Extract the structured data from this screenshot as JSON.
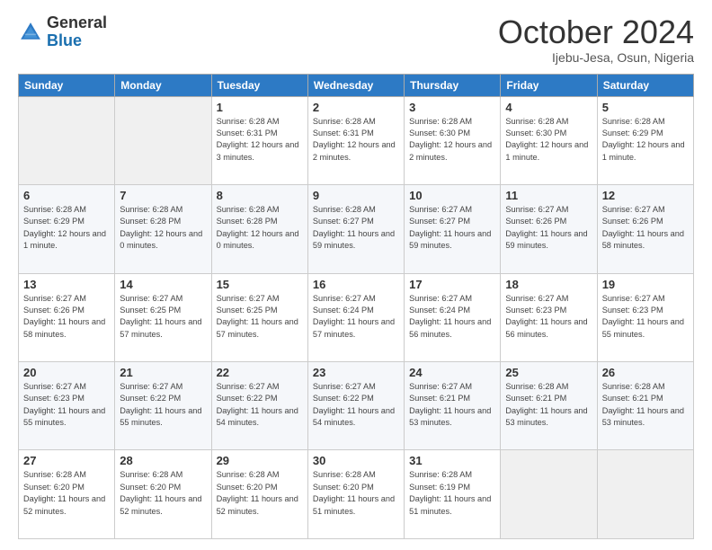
{
  "logo": {
    "general": "General",
    "blue": "Blue"
  },
  "title": "October 2024",
  "location": "Ijebu-Jesa, Osun, Nigeria",
  "headers": [
    "Sunday",
    "Monday",
    "Tuesday",
    "Wednesday",
    "Thursday",
    "Friday",
    "Saturday"
  ],
  "weeks": [
    [
      {
        "day": "",
        "info": ""
      },
      {
        "day": "",
        "info": ""
      },
      {
        "day": "1",
        "info": "Sunrise: 6:28 AM\nSunset: 6:31 PM\nDaylight: 12 hours and 3 minutes."
      },
      {
        "day": "2",
        "info": "Sunrise: 6:28 AM\nSunset: 6:31 PM\nDaylight: 12 hours and 2 minutes."
      },
      {
        "day": "3",
        "info": "Sunrise: 6:28 AM\nSunset: 6:30 PM\nDaylight: 12 hours and 2 minutes."
      },
      {
        "day": "4",
        "info": "Sunrise: 6:28 AM\nSunset: 6:30 PM\nDaylight: 12 hours and 1 minute."
      },
      {
        "day": "5",
        "info": "Sunrise: 6:28 AM\nSunset: 6:29 PM\nDaylight: 12 hours and 1 minute."
      }
    ],
    [
      {
        "day": "6",
        "info": "Sunrise: 6:28 AM\nSunset: 6:29 PM\nDaylight: 12 hours and 1 minute."
      },
      {
        "day": "7",
        "info": "Sunrise: 6:28 AM\nSunset: 6:28 PM\nDaylight: 12 hours and 0 minutes."
      },
      {
        "day": "8",
        "info": "Sunrise: 6:28 AM\nSunset: 6:28 PM\nDaylight: 12 hours and 0 minutes."
      },
      {
        "day": "9",
        "info": "Sunrise: 6:28 AM\nSunset: 6:27 PM\nDaylight: 11 hours and 59 minutes."
      },
      {
        "day": "10",
        "info": "Sunrise: 6:27 AM\nSunset: 6:27 PM\nDaylight: 11 hours and 59 minutes."
      },
      {
        "day": "11",
        "info": "Sunrise: 6:27 AM\nSunset: 6:26 PM\nDaylight: 11 hours and 59 minutes."
      },
      {
        "day": "12",
        "info": "Sunrise: 6:27 AM\nSunset: 6:26 PM\nDaylight: 11 hours and 58 minutes."
      }
    ],
    [
      {
        "day": "13",
        "info": "Sunrise: 6:27 AM\nSunset: 6:26 PM\nDaylight: 11 hours and 58 minutes."
      },
      {
        "day": "14",
        "info": "Sunrise: 6:27 AM\nSunset: 6:25 PM\nDaylight: 11 hours and 57 minutes."
      },
      {
        "day": "15",
        "info": "Sunrise: 6:27 AM\nSunset: 6:25 PM\nDaylight: 11 hours and 57 minutes."
      },
      {
        "day": "16",
        "info": "Sunrise: 6:27 AM\nSunset: 6:24 PM\nDaylight: 11 hours and 57 minutes."
      },
      {
        "day": "17",
        "info": "Sunrise: 6:27 AM\nSunset: 6:24 PM\nDaylight: 11 hours and 56 minutes."
      },
      {
        "day": "18",
        "info": "Sunrise: 6:27 AM\nSunset: 6:23 PM\nDaylight: 11 hours and 56 minutes."
      },
      {
        "day": "19",
        "info": "Sunrise: 6:27 AM\nSunset: 6:23 PM\nDaylight: 11 hours and 55 minutes."
      }
    ],
    [
      {
        "day": "20",
        "info": "Sunrise: 6:27 AM\nSunset: 6:23 PM\nDaylight: 11 hours and 55 minutes."
      },
      {
        "day": "21",
        "info": "Sunrise: 6:27 AM\nSunset: 6:22 PM\nDaylight: 11 hours and 55 minutes."
      },
      {
        "day": "22",
        "info": "Sunrise: 6:27 AM\nSunset: 6:22 PM\nDaylight: 11 hours and 54 minutes."
      },
      {
        "day": "23",
        "info": "Sunrise: 6:27 AM\nSunset: 6:22 PM\nDaylight: 11 hours and 54 minutes."
      },
      {
        "day": "24",
        "info": "Sunrise: 6:27 AM\nSunset: 6:21 PM\nDaylight: 11 hours and 53 minutes."
      },
      {
        "day": "25",
        "info": "Sunrise: 6:28 AM\nSunset: 6:21 PM\nDaylight: 11 hours and 53 minutes."
      },
      {
        "day": "26",
        "info": "Sunrise: 6:28 AM\nSunset: 6:21 PM\nDaylight: 11 hours and 53 minutes."
      }
    ],
    [
      {
        "day": "27",
        "info": "Sunrise: 6:28 AM\nSunset: 6:20 PM\nDaylight: 11 hours and 52 minutes."
      },
      {
        "day": "28",
        "info": "Sunrise: 6:28 AM\nSunset: 6:20 PM\nDaylight: 11 hours and 52 minutes."
      },
      {
        "day": "29",
        "info": "Sunrise: 6:28 AM\nSunset: 6:20 PM\nDaylight: 11 hours and 52 minutes."
      },
      {
        "day": "30",
        "info": "Sunrise: 6:28 AM\nSunset: 6:20 PM\nDaylight: 11 hours and 51 minutes."
      },
      {
        "day": "31",
        "info": "Sunrise: 6:28 AM\nSunset: 6:19 PM\nDaylight: 11 hours and 51 minutes."
      },
      {
        "day": "",
        "info": ""
      },
      {
        "day": "",
        "info": ""
      }
    ]
  ]
}
